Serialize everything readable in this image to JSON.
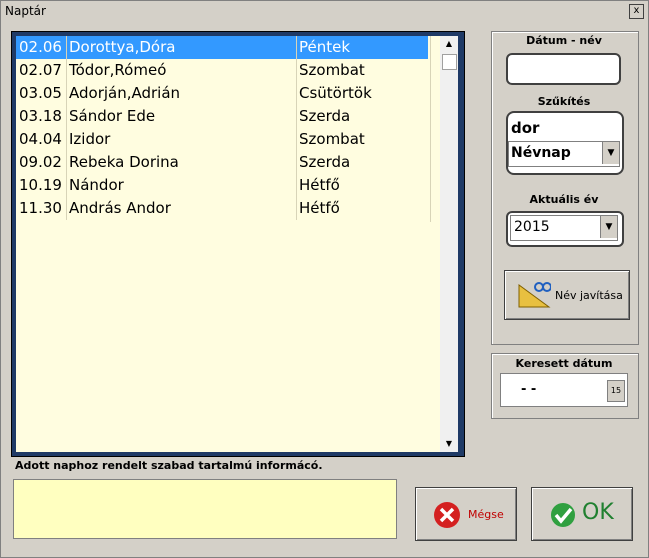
{
  "window": {
    "title": "Naptár",
    "close_label": "x"
  },
  "list": {
    "rows": [
      {
        "date": "02.06",
        "names": "Dorottya,Dóra",
        "day": "Péntek",
        "selected": true
      },
      {
        "date": "02.07",
        "names": "Tódor,Rómeó",
        "day": "Szombat"
      },
      {
        "date": "03.05",
        "names": "Adorján,Adrián",
        "day": "Csütörtök"
      },
      {
        "date": "03.18",
        "names": "Sándor Ede",
        "day": "Szerda"
      },
      {
        "date": "04.04",
        "names": "Izidor",
        "day": "Szombat"
      },
      {
        "date": "09.02",
        "names": "Rebeka Dorina",
        "day": "Szerda"
      },
      {
        "date": "10.19",
        "names": "Nándor",
        "day": "Hétfő"
      },
      {
        "date": "11.30",
        "names": "András Andor",
        "day": "Hétfő"
      }
    ]
  },
  "info": {
    "label": "Adott naphoz rendelt szabad tartalmú informácó.",
    "value": ""
  },
  "datum_nev": {
    "label": "Dátum - név",
    "value": ""
  },
  "szukites": {
    "label": "Szűkítés",
    "text_value": "dor",
    "type_value": "Névnap"
  },
  "aktualis_ev": {
    "label": "Aktuális év",
    "value": "2015"
  },
  "nev_javitasa": {
    "label": "Név javítása"
  },
  "keresett_datum": {
    "label": "Keresett dátum",
    "value": "-  -",
    "calendar_label": "15"
  },
  "buttons": {
    "cancel": "Mégse",
    "ok": "OK"
  }
}
